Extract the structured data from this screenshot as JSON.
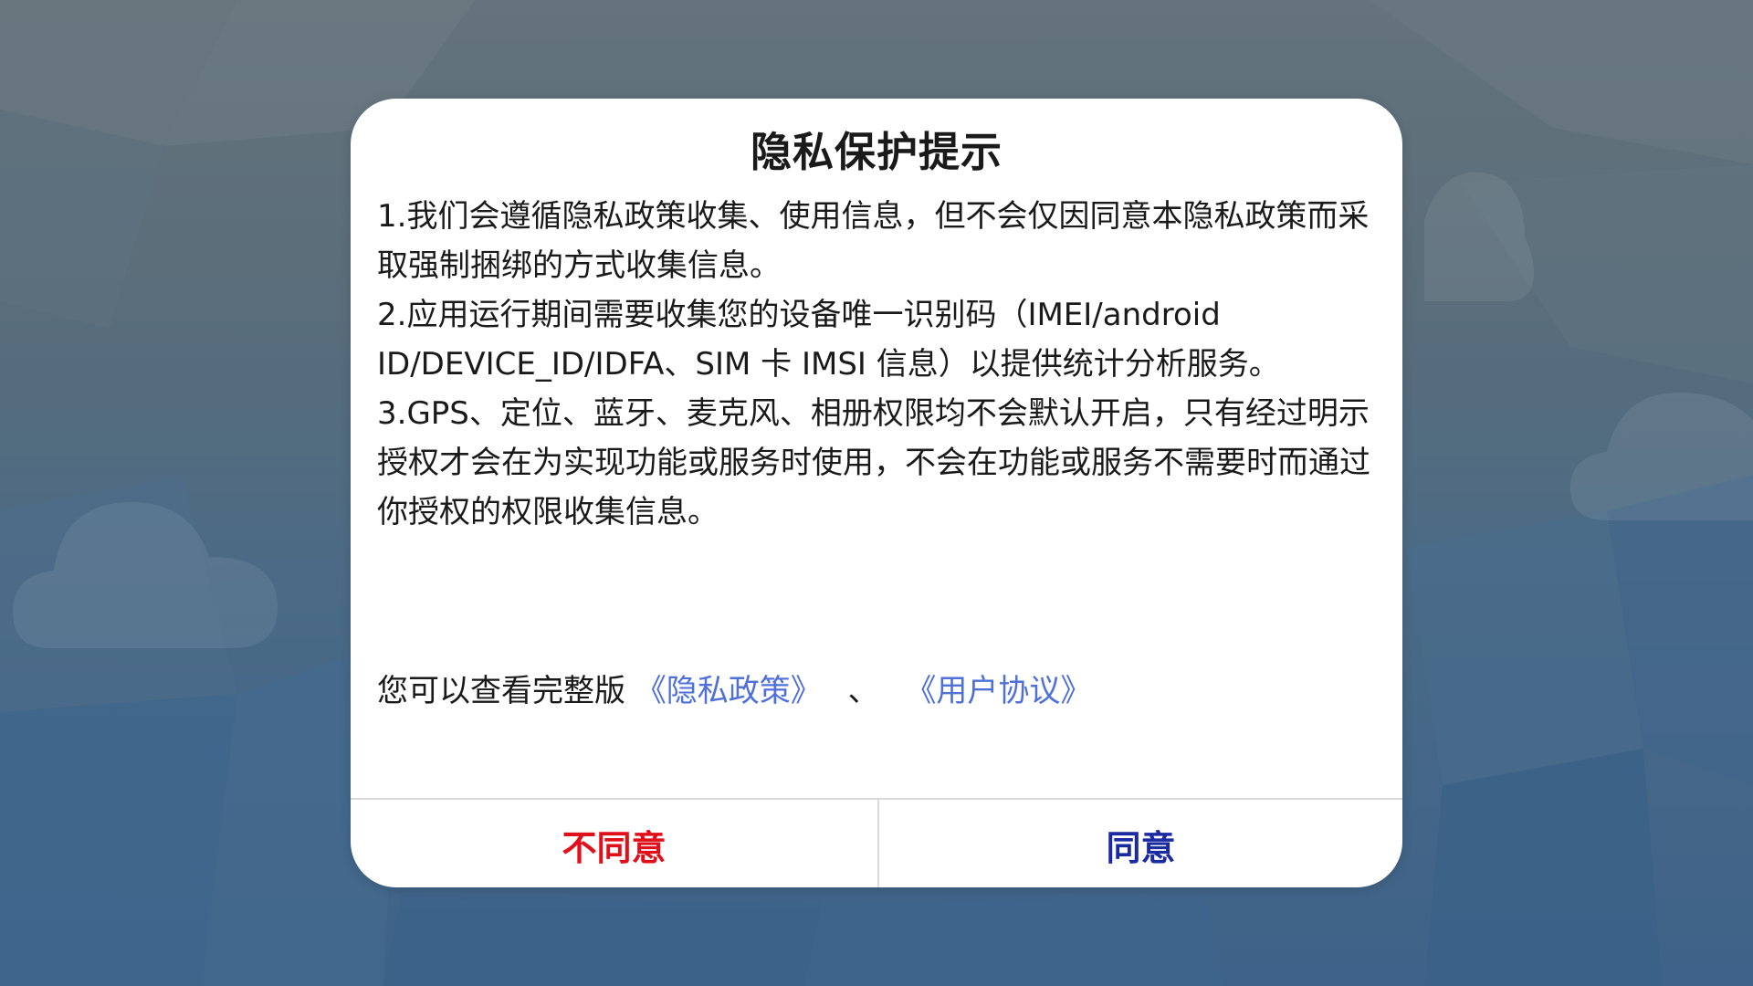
{
  "dialog": {
    "title": "隐私保护提示",
    "paragraphs": [
      "1.我们会遵循隐私政策收集、使用信息，但不会仅因同意本隐私政策而采取强制捆绑的方式收集信息。",
      "2.应用运行期间需要收集您的设备唯一识别码（IMEI/android ID/DEVICE_ID/IDFA、SIM 卡 IMSI 信息）以提供统计分析服务。",
      "3.GPS、定位、蓝牙、麦克风、相册权限均不会默认开启，只有经过明示授权才会在为实现功能或服务时使用，不会在功能或服务不需要时而通过你授权的权限收集信息。"
    ],
    "links_prefix": "您可以查看完整版",
    "privacy_policy_link": "《隐私政策》",
    "separator": "、",
    "user_agreement_link": "《用户协议》",
    "disagree_label": "不同意",
    "agree_label": "同意"
  },
  "colors": {
    "link": "#4f6fd9",
    "disagree": "#e0101b",
    "agree": "#1a2aa0",
    "background_top": "#64737c",
    "background_bottom": "#3e6289"
  }
}
